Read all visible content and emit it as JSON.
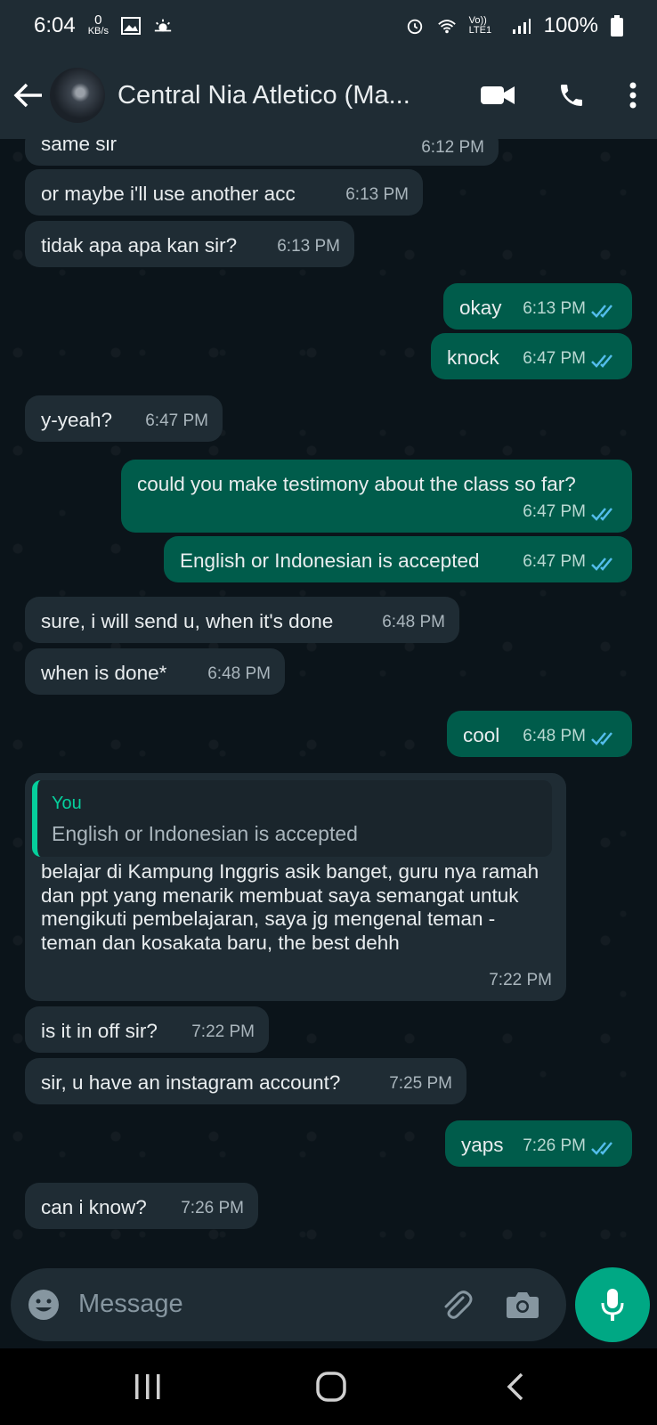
{
  "status_bar": {
    "time": "6:04",
    "net_speed_value": "0",
    "net_speed_unit": "KB/s",
    "network": "Vo)) LTE1",
    "battery": "100%"
  },
  "header": {
    "back_icon": "arrow-left-icon",
    "contact_name": "Central Nia Atletico (Ma...",
    "video_icon": "video-call-icon",
    "call_icon": "phone-icon",
    "menu_icon": "more-vert-icon"
  },
  "messages": [
    {
      "dir": "in",
      "text": "same sir",
      "time": "6:12 PM"
    },
    {
      "dir": "in",
      "text": "or maybe i'll use another acc",
      "time": "6:13 PM"
    },
    {
      "dir": "in",
      "text": "tidak apa apa kan sir?",
      "time": "6:13 PM"
    },
    {
      "dir": "out",
      "text": "okay",
      "time": "6:13 PM"
    },
    {
      "dir": "out",
      "text": "knock",
      "time": "6:47 PM"
    },
    {
      "dir": "in",
      "text": "y-yeah?",
      "time": "6:47 PM"
    },
    {
      "dir": "out",
      "text": "could you make testimony about the class so far?",
      "time": "6:47 PM"
    },
    {
      "dir": "out",
      "text": "English or Indonesian is accepted",
      "time": "6:47 PM"
    },
    {
      "dir": "in",
      "text": "sure, i will send u, when it's done",
      "time": "6:48 PM"
    },
    {
      "dir": "in",
      "text": "when is done*",
      "time": "6:48 PM"
    },
    {
      "dir": "out",
      "text": "cool",
      "time": "6:48 PM"
    },
    {
      "dir": "in",
      "quote_author": "You",
      "quote_text": "English or Indonesian is accepted",
      "text": "belajar di Kampung Inggris asik banget, guru nya ramah dan ppt yang menarik membuat saya semangat untuk mengikuti pembelajaran, saya jg mengenal teman - teman dan kosakata baru, the best dehh",
      "time": "7:22 PM"
    },
    {
      "dir": "in",
      "text": "is it in off sir?",
      "time": "7:22 PM"
    },
    {
      "dir": "in",
      "text": "sir, u have an instagram account?",
      "time": "7:25 PM"
    },
    {
      "dir": "out",
      "text": "yaps",
      "time": "7:26 PM"
    },
    {
      "dir": "in",
      "text": "can i know?",
      "time": "7:26 PM"
    }
  ],
  "input": {
    "placeholder": "Message",
    "emoji_icon": "emoji-icon",
    "attach_icon": "paperclip-icon",
    "camera_icon": "camera-icon",
    "mic_icon": "microphone-icon"
  },
  "nav": {
    "recents_icon": "recents-icon",
    "home_icon": "home-icon",
    "back_icon": "nav-back-icon"
  }
}
